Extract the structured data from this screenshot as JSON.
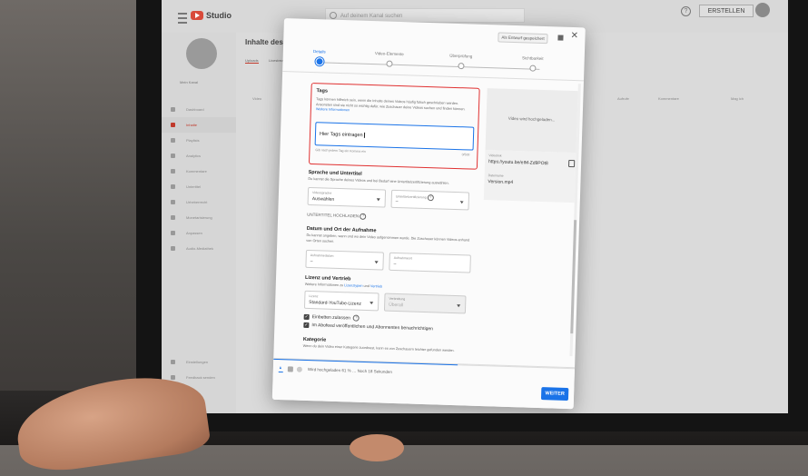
{
  "app": {
    "logo_text": "Studio",
    "search_placeholder": "Auf deinem Kanal suchen",
    "create_label": "ERSTELLEN",
    "help_glyph": "?",
    "accent_color": "#1a73e8",
    "error_color": "#e03030"
  },
  "sidebar": {
    "channel_name": "Mein Kanal",
    "items": [
      {
        "label": "Dashboard",
        "icon": "dashboard-icon"
      },
      {
        "label": "Inhalte",
        "icon": "content-icon",
        "active": true
      },
      {
        "label": "Playlists",
        "icon": "playlist-icon"
      },
      {
        "label": "Analytics",
        "icon": "analytics-icon"
      },
      {
        "label": "Kommentare",
        "icon": "comments-icon"
      },
      {
        "label": "Untertitel",
        "icon": "subtitles-icon"
      },
      {
        "label": "Urheberrecht",
        "icon": "copyright-icon"
      },
      {
        "label": "Monetarisierung",
        "icon": "money-icon"
      },
      {
        "label": "Anpassen",
        "icon": "customize-icon"
      },
      {
        "label": "Audio-Mediathek",
        "icon": "audio-icon"
      }
    ],
    "bottom_items": [
      {
        "label": "Einstellungen",
        "icon": "settings-icon"
      },
      {
        "label": "Feedback senden",
        "icon": "feedback-icon"
      }
    ]
  },
  "content": {
    "title": "Inhalte des Kanal",
    "tabs": [
      "Uploads",
      "Livestreams"
    ],
    "columns": [
      "Video",
      "Aufrufe",
      "Kommentare",
      "Mag ich"
    ]
  },
  "modal": {
    "draft_badge": "Als Entwurf gespeichert",
    "close_glyph": "✕",
    "steps": [
      {
        "label": "Details",
        "current": true
      },
      {
        "label": "Video-Elemente",
        "current": false
      },
      {
        "label": "Überprüfung",
        "current": false
      },
      {
        "label": "Sichtbarkeit",
        "current": false
      }
    ],
    "tags": {
      "title": "Tags",
      "description": "Tags können hilfreich sein, wenn die Inhalte deines Videos häufig falsch geschrieben werden. Ansonsten sind sie nicht so wichtig dafür, wie Zuschauer deine Videos suchen und finden können.",
      "more_link": "Weitere Informationen",
      "input_value": "Hier Tags eintragen",
      "hint": "Gib nach jedem Tag ein Komma ein",
      "counter": "0/500"
    },
    "preview": {
      "status": "Video wird hochgeladen...",
      "link_label": "Videolink",
      "link_value": "https://youtu.be/eIM-Zd9POt8",
      "file_label": "Dateiname",
      "file_value": "Version.mp4"
    },
    "language": {
      "title": "Sprache und Untertitel",
      "description": "Du kannst die Sprache deines Videos und bei Bedarf eine Untertitelzertifizierung auswählen.",
      "video_language_label": "Videosprache",
      "video_language_value": "Auswählen",
      "subtitle_cert_label": "Untertitelzertifizierung",
      "subtitle_cert_value": "–",
      "upload_subtitles": "UNTERTITEL HOCHLADEN"
    },
    "recording": {
      "title": "Datum und Ort der Aufnahme",
      "description": "Du kannst angeben, wann und wo dein Video aufgenommen wurde. Die Zuschauer können Videos anhand von Orten suchen.",
      "date_label": "Aufnahmedatum",
      "date_value": "–",
      "place_label": "Aufnahmeort",
      "place_value": "–"
    },
    "license": {
      "title": "Lizenz und Vertrieb",
      "description_prefix": "Weitere Informationen zu",
      "license_types_link": "Lizenztypen",
      "and": "und",
      "distribution_link": "Vertrieb",
      "license_label": "Lizenz",
      "license_value": "Standard-YouTube-Lizenz",
      "distribution_label": "Verbreitung",
      "distribution_value": "Überall",
      "allow_embed": "Einbetten zulassen",
      "notify_subs": "Im Abofeed veröffentlichen und Abonnenten benachrichtigen"
    },
    "category": {
      "title": "Kategorie",
      "description": "Wenn du dein Video einer Kategorie zuordnest, kann es von Zuschauern leichter gefunden werden."
    },
    "footer": {
      "progress_text": "Wird hochgeladen 61 % … Noch 18 Sekunden",
      "progress_value": 0.61,
      "next_label": "WEITER"
    }
  }
}
